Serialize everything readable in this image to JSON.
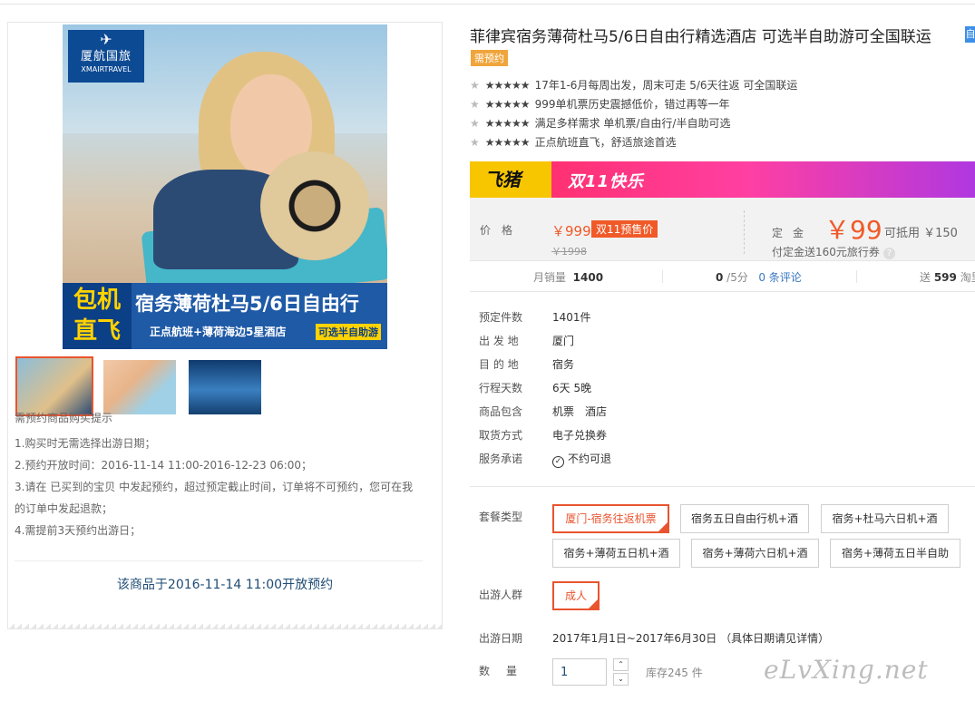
{
  "colors": {
    "accent": "#e8542e",
    "price": "#f05a28",
    "link": "#3b78c2",
    "promo_yellow": "#f7c600"
  },
  "brand": {
    "bird": "✈",
    "cn": "厦航国旅",
    "en": "XMAIRTRAVEL"
  },
  "banner": {
    "left_line1": "包机",
    "left_line2": "直飞",
    "title": "宿务薄荷杜马5/6日自由行",
    "sub": "正点航班+薄荷海边5星酒店",
    "tag": "可选半自助游"
  },
  "notice": {
    "title": "需预约商品购买提示",
    "lines": [
      "1.购买时无需选择出游日期；",
      "2.预约开放时间：2016-11-14 11:00-2016-12-23 06:00；",
      "3.请在 已买到的宝贝 中发起预约，超过预定截止时间，订单将不可预约，您可在我的订单中发起退款；",
      "4.需提前3天预约出游日；"
    ],
    "open_note": "该商品于2016-11-14 11:00开放预约"
  },
  "product": {
    "title": "菲律宾宿务薄荷杜马5/6日自由行精选酒店 可选半自助游可全国联运",
    "title_badge": "自",
    "need_reserve": "需预约",
    "features": [
      {
        "stars": "★★★★★",
        "text": "17年1-6月每周出发，周末可走 5/6天往返 可全国联运"
      },
      {
        "stars": "★★★★★",
        "text": "999单机票历史震撼低价，错过再等一年"
      },
      {
        "stars": "★★★★★",
        "text": "满足多样需求 单机票/自由行/半自助可选"
      },
      {
        "stars": "★★★★★",
        "text": "正点航班直飞，舒适旅途首选"
      }
    ]
  },
  "promo": {
    "logo": "飞猪",
    "text": "双11快乐"
  },
  "price": {
    "label": "价格",
    "now": "￥999",
    "presale_tag": "双11预售价",
    "old": "￥1998",
    "deposit_label": "定金",
    "deposit": "￥99",
    "deduct": "可抵用 ￥150",
    "coupon": "付定金送160元旅行券",
    "help": "?"
  },
  "stats": {
    "monthly_label": "月销量",
    "monthly_value": "1400",
    "score_value": "0",
    "score_suffix": " /5分",
    "comments": "0 条评论",
    "gift_prefix": "送 ",
    "gift_value": "599",
    "gift_suffix": " 淘里"
  },
  "attrs": [
    {
      "k": "预定件数",
      "v": "1401件"
    },
    {
      "k": "出 发 地",
      "v": "厦门"
    },
    {
      "k": "目 的 地",
      "v": "宿务"
    },
    {
      "k": "行程天数",
      "v": "6天 5晚"
    },
    {
      "k": "商品包含",
      "v": "机票　酒店"
    },
    {
      "k": "取货方式",
      "v": "电子兑换券"
    },
    {
      "k": "服务承诺",
      "v": "不约可退"
    }
  ],
  "packages": {
    "label": "套餐类型",
    "options": [
      "厦门-宿务往返机票",
      "宿务五日自由行机+酒",
      "宿务+杜马六日机+酒",
      "宿务+薄荷五日机+酒",
      "宿务+薄荷六日机+酒",
      "宿务+薄荷五日半自助"
    ],
    "selected": "厦门-宿务往返机票"
  },
  "crowd": {
    "label": "出游人群",
    "option": "成人"
  },
  "date": {
    "label": "出游日期",
    "value": "2017年1月1日~2017年6月30日 （具体日期请见详情）"
  },
  "quantity": {
    "label": "数量",
    "value": "1",
    "up": "⌃",
    "down": "⌄",
    "stock": "库存245 件"
  },
  "watermark": "eLvXing.net"
}
